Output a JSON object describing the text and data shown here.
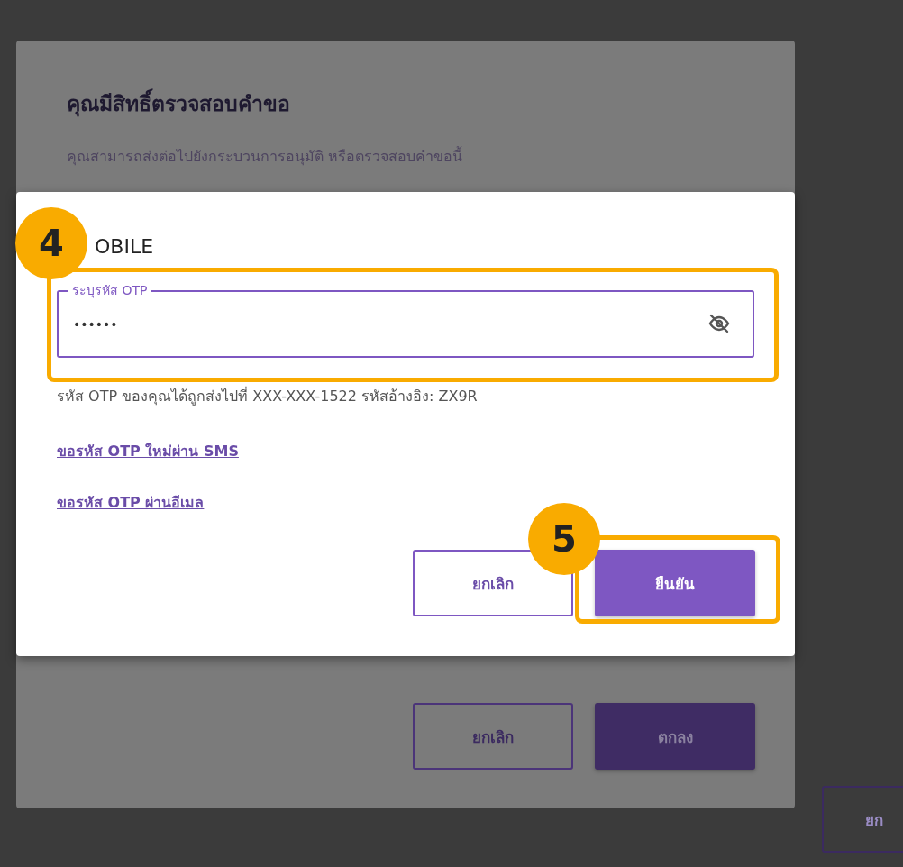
{
  "background_dialog": {
    "title": "คุณมีสิทธิ์ตรวจสอบคำขอ",
    "subtitle": "คุณสามารถส่งต่อไปยังกระบวนการอนุมัติ หรือตรวจสอบคำขอนี้",
    "buttons": [
      {
        "label": "ยกเลิก",
        "kind": "outline"
      },
      {
        "label": "ตกลง",
        "kind": "filled"
      }
    ]
  },
  "background_page_button": {
    "label": "ยก"
  },
  "otp_dialog": {
    "title": "OBILE",
    "otp_field": {
      "label": "ระบุรหัส OTP",
      "value": "••••••"
    },
    "helper": "รหัส OTP ของคุณได้ถูกส่งไปที่ XXX-XXX-1522 รหัสอ้างอิง: ZX9R",
    "links": [
      "ขอรหัส OTP ใหม่ผ่าน SMS",
      "ขอรหัส OTP ผ่านอีเมล"
    ],
    "buttons": [
      {
        "label": "ยกเลิก",
        "kind": "outline"
      },
      {
        "label": "ยืนยัน",
        "kind": "filled"
      }
    ]
  },
  "annotations": [
    {
      "number": "4"
    },
    {
      "number": "5"
    }
  ]
}
